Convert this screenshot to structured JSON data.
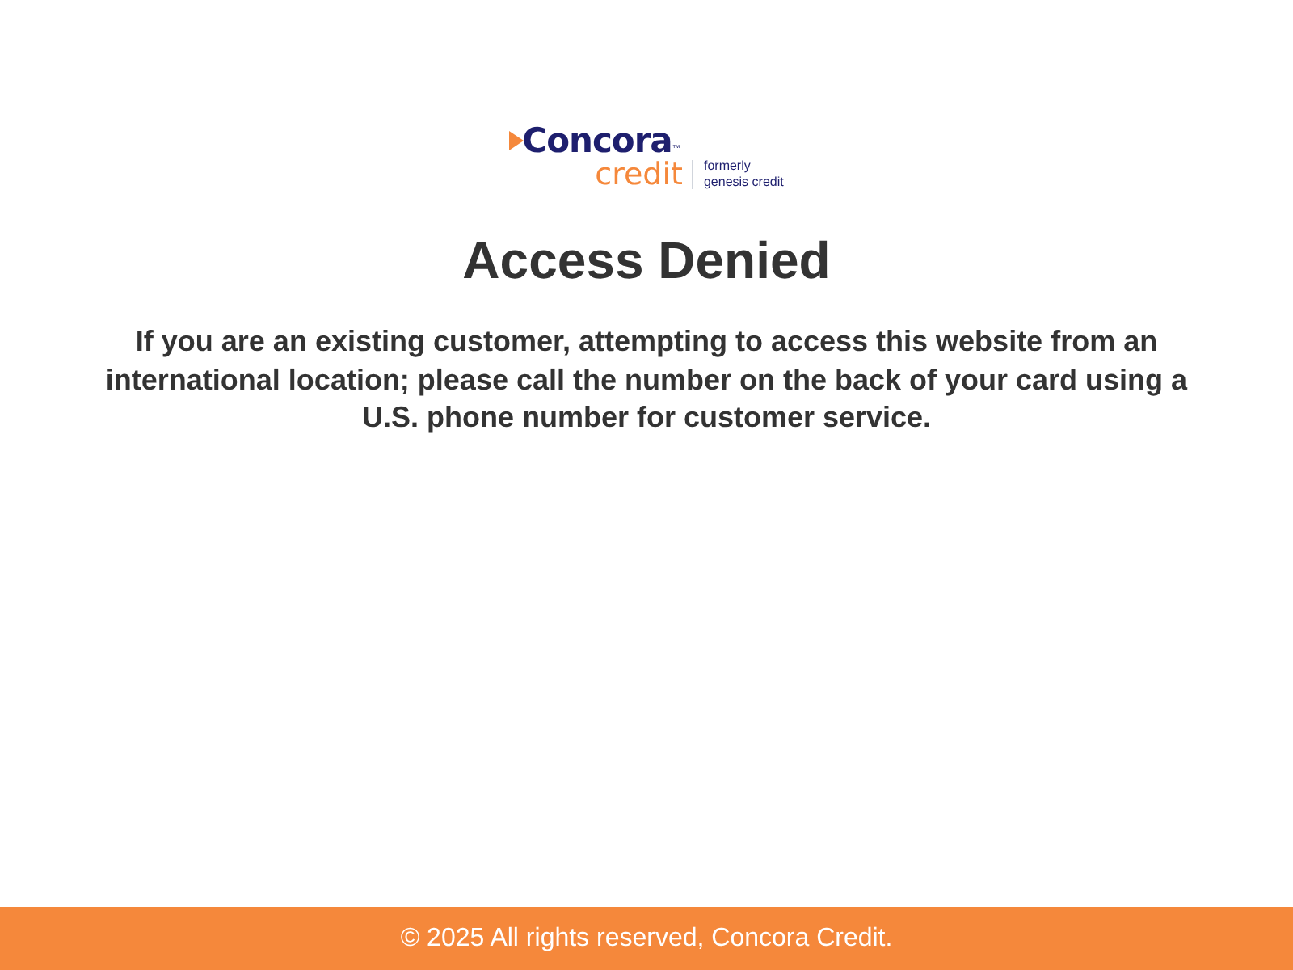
{
  "logo": {
    "brand": "Concora",
    "trademark": "™",
    "sub": "credit",
    "note_lines": [
      "formerly",
      "genesis credit"
    ]
  },
  "title": "Access Denied",
  "message": "If you are an existing customer, attempting to access this website from an international location; please call the number on the back of your card using a U.S. phone number for customer service.",
  "footer": "© 2025 All rights reserved, Concora Credit."
}
